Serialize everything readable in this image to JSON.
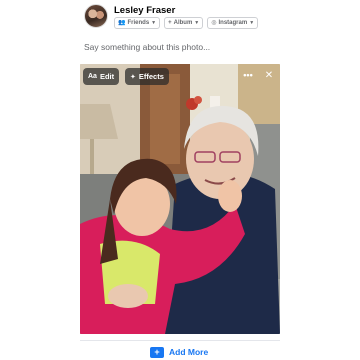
{
  "post": {
    "user_name": "Lesley Fraser",
    "audience": {
      "label": "Friends",
      "icon": "friends-icon"
    },
    "album": {
      "label": "Album",
      "icon": "plus-icon"
    },
    "instagram": {
      "label": "Instagram",
      "icon": "instagram-icon"
    },
    "composer_placeholder": "Say something about this photo..."
  },
  "photo_toolbar": {
    "edit_label": "Edit",
    "effects_label": "Effects",
    "more_icon": "more-horizontal-icon",
    "close_icon": "close-icon"
  },
  "footer": {
    "add_more_label": "Add More",
    "add_more_icon": "add-photo-icon"
  },
  "colors": {
    "accent": "#1877f2",
    "secondary_text": "#65676b",
    "overlay": "#282828"
  }
}
